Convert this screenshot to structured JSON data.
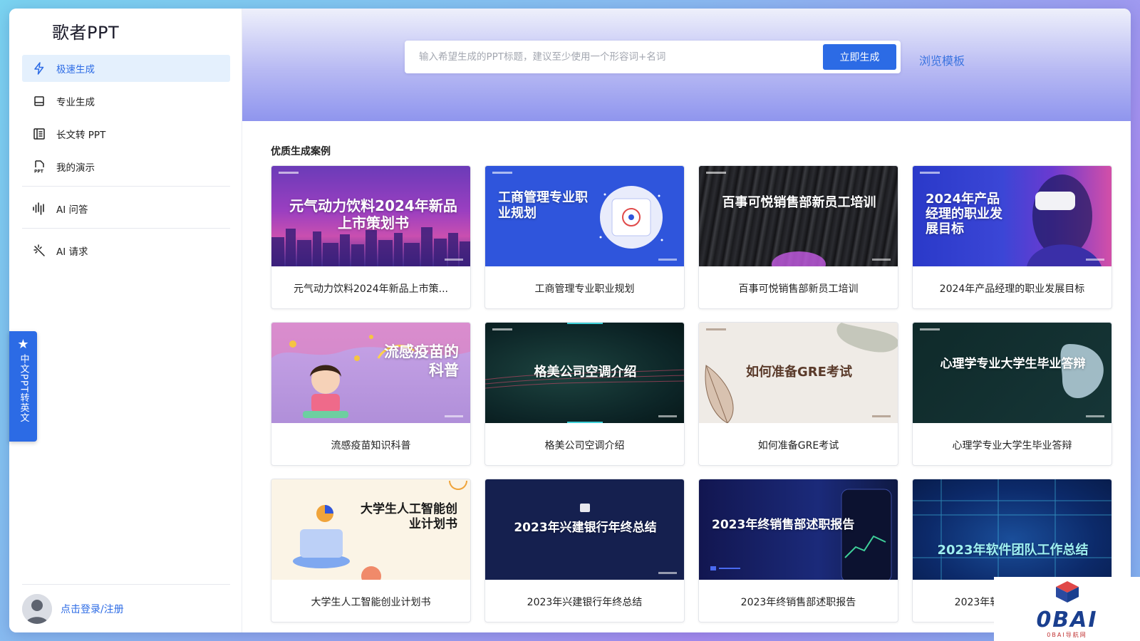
{
  "app": {
    "title": "歌者PPT"
  },
  "sidebar": {
    "items": [
      {
        "label": "极速生成",
        "icon": "lightning-icon",
        "active": true
      },
      {
        "label": "专业生成",
        "icon": "document-icon",
        "active": false
      },
      {
        "label": "长文转 PPT",
        "icon": "long-text-icon",
        "active": false
      },
      {
        "label": "我的演示",
        "icon": "ppt-file-icon",
        "active": false
      },
      {
        "label": "AI 问答",
        "icon": "ai-wave-icon",
        "active": false
      },
      {
        "label": "AI 请求",
        "icon": "magic-wand-icon",
        "active": false
      }
    ],
    "login_label": "点击登录/注册"
  },
  "float_tab": {
    "label": "中文PPT转英文",
    "icon": "star-icon"
  },
  "hero": {
    "search_placeholder": "输入希望生成的PPT标题，建议至少使用一个形容词+名词",
    "generate_label": "立即生成",
    "browse_label": "浏览模板"
  },
  "cases": {
    "title": "优质生成案例",
    "items": [
      {
        "thumb_title": "元气动力饮料2024年新品上市策划书",
        "caption": "元气动力饮料2024年新品上市策..."
      },
      {
        "thumb_title": "工商管理专业职业规划",
        "caption": "工商管理专业职业规划"
      },
      {
        "thumb_title": "百事可悦销售部新员工培训",
        "caption": "百事可悦销售部新员工培训"
      },
      {
        "thumb_title": "2024年产品经理的职业发展目标",
        "caption": "2024年产品经理的职业发展目标"
      },
      {
        "thumb_title": "流感疫苗的科普",
        "caption": "流感疫苗知识科普"
      },
      {
        "thumb_title": "格美公司空调介绍",
        "caption": "格美公司空调介绍"
      },
      {
        "thumb_title": "如何准备GRE考试",
        "caption": "如何准备GRE考试"
      },
      {
        "thumb_title": "心理学专业大学生毕业答辩",
        "caption": "心理学专业大学生毕业答辩"
      },
      {
        "thumb_title": "大学生人工智能创业计划书",
        "caption": "大学生人工智能创业计划书"
      },
      {
        "thumb_title": "2023年兴建银行年终总结",
        "caption": "2023年兴建银行年终总结"
      },
      {
        "thumb_title": "2023年终销售部述职报告",
        "caption": "2023年终销售部述职报告"
      },
      {
        "thumb_title": "2023年软件团队工作总结",
        "caption": "2023年软件团队工作总结"
      }
    ]
  },
  "watermark": {
    "text": "0BAI",
    "sub": "0BAI导航网"
  },
  "colors": {
    "accent": "#2c6be5",
    "active_bg": "#e4f0fd"
  }
}
